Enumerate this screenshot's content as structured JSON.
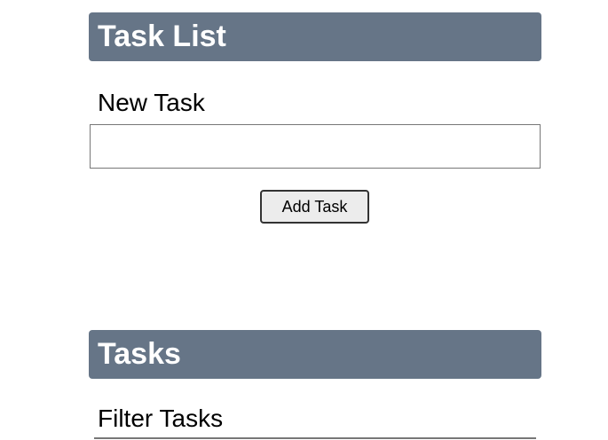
{
  "add_section": {
    "title": "Task List",
    "new_task_label": "New Task",
    "new_task_value": "",
    "add_button": "Add Task"
  },
  "tasks_section": {
    "title": "Tasks",
    "filter_label": "Filter Tasks",
    "filter_value": ""
  },
  "colors": {
    "header_bg": "#667587"
  }
}
